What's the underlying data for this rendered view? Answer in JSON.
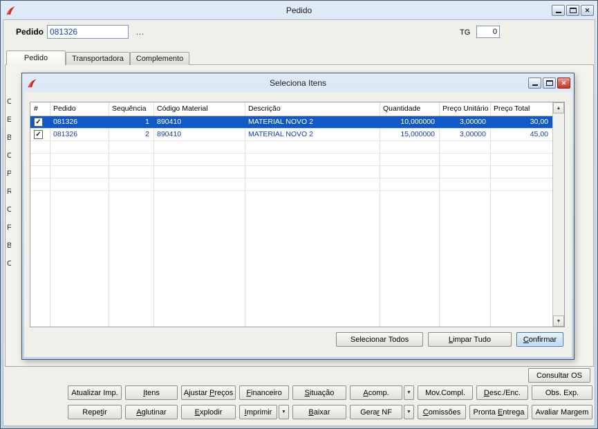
{
  "window": {
    "title": "Pedido"
  },
  "icons": {
    "close": "✕",
    "dropdown": "▼",
    "scroll_up": "▲",
    "scroll_down": "▼",
    "check": "✓"
  },
  "colors": {
    "titlebar_top": "#dfeaf7",
    "titlebar_bottom": "#bfd4ec",
    "selection_blue": "#1159c7",
    "row_text_blue": "#12409e",
    "close_red": "#c23a2d",
    "focus_blue": "#3a76ba"
  },
  "header": {
    "pedido_label": "Pedido",
    "pedido_value": "081326",
    "ellipsis": "...",
    "tg_label": "TG",
    "tg_value": "0"
  },
  "tabs": [
    {
      "label": "Pedido"
    },
    {
      "label": "Transportadora"
    },
    {
      "label": "Complemento"
    }
  ],
  "background_fragments": [
    "C",
    "E",
    "B",
    "C",
    "P",
    "R",
    "C",
    "F",
    "B",
    "C"
  ],
  "dialog": {
    "title": "Seleciona Itens",
    "grid": {
      "columns": [
        "#",
        "Pedido",
        "Sequência",
        "Código Material",
        "Descrição",
        "Quantidade",
        "Preço Unitário",
        "Preço Total"
      ],
      "rows": [
        {
          "checked": true,
          "pedido": "081326",
          "sequencia": "1",
          "codigo_material": "890410",
          "descricao": "MATERIAL NOVO 2",
          "quantidade": "10,000000",
          "preco_unitario": "3,00000",
          "preco_total": "30,00"
        },
        {
          "checked": true,
          "pedido": "081326",
          "sequencia": "2",
          "codigo_material": "890410",
          "descricao": "MATERIAL NOVO 2",
          "quantidade": "15,000000",
          "preco_unitario": "3,00000",
          "preco_total": "45,00"
        }
      ]
    },
    "buttons": {
      "selecionar_todos": {
        "label": "Selecionar Todos"
      },
      "limpar_tudo": {
        "label": "Limpar Tudo",
        "u": 0
      },
      "confirmar": {
        "label": "Confirmar",
        "u": 0
      }
    }
  },
  "actions": {
    "consultar_os": {
      "label": "Consultar OS"
    },
    "row1": [
      {
        "label": "Atualizar Imp."
      },
      {
        "label": "Itens",
        "u": 0
      },
      {
        "label": "Ajustar Preços",
        "u": 8
      },
      {
        "label": "Financeiro",
        "u": 0
      },
      {
        "label": "Situação",
        "u": 0
      },
      {
        "label": "Acomp.",
        "u": 0
      },
      {
        "label": "Mov.Compl."
      },
      {
        "label": "Desc./Enc.",
        "u": 0
      },
      {
        "label": "Obs. Exp."
      }
    ],
    "row2": [
      {
        "label": "Repetir",
        "u": 4
      },
      {
        "label": "Aglutinar",
        "u": 0
      },
      {
        "label": "Explodir",
        "u": 0
      },
      {
        "label": "Imprimir",
        "u": 0
      },
      {
        "label": "Baixar",
        "u": 0
      },
      {
        "label": "Gerar NF",
        "u": 4
      },
      {
        "label": "Comissões",
        "u": 0
      },
      {
        "label": "Pronta Entrega",
        "u": 7
      },
      {
        "label": "Avaliar Margem"
      }
    ]
  }
}
